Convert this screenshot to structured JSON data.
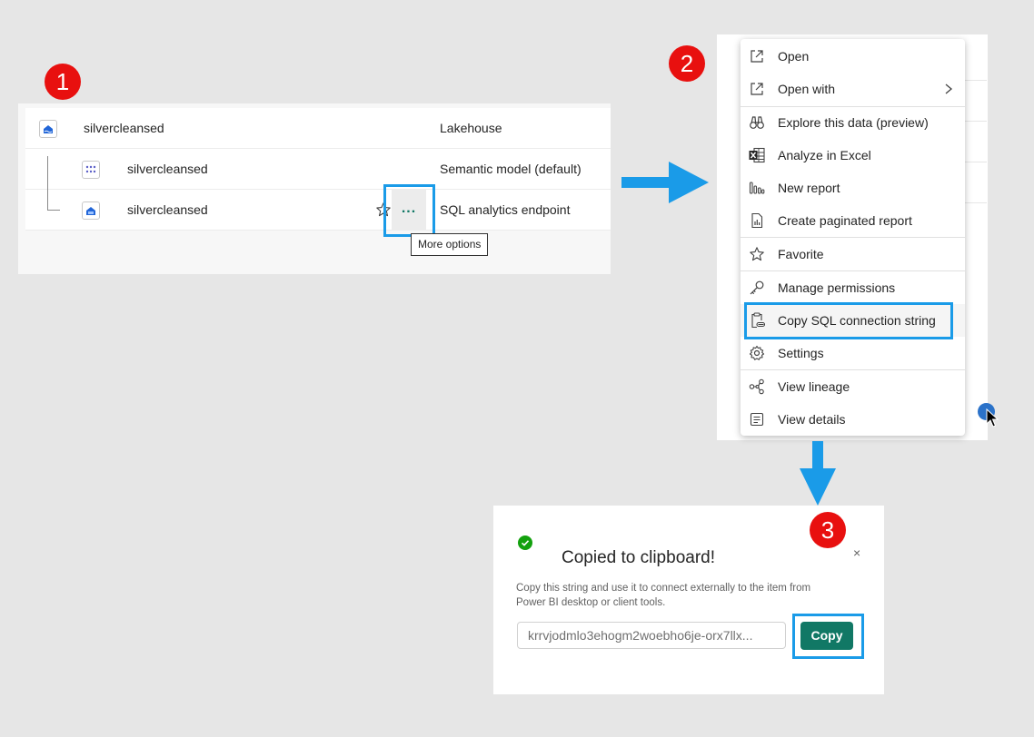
{
  "steps": [
    "1",
    "2",
    "3"
  ],
  "panel1": {
    "rows": [
      {
        "name": "silvercleansed",
        "type": "Lakehouse",
        "icon": "lakehouse-icon"
      },
      {
        "name": "silvercleansed",
        "type": "Semantic model (default)",
        "icon": "semantic-model-icon"
      },
      {
        "name": "silvercleansed",
        "type": "SQL analytics endpoint",
        "icon": "sql-endpoint-icon"
      }
    ],
    "more_button_label": "...",
    "tooltip": "More options"
  },
  "menu": {
    "items": [
      {
        "label": "Open",
        "icon": "open-external-icon"
      },
      {
        "label": "Open with",
        "icon": "open-external-icon",
        "has_submenu": true
      },
      {
        "label": "Explore this data (preview)",
        "icon": "binoculars-icon"
      },
      {
        "label": "Analyze in Excel",
        "icon": "excel-icon"
      },
      {
        "label": "New report",
        "icon": "report-bars-icon"
      },
      {
        "label": "Create paginated report",
        "icon": "paginated-report-icon"
      },
      {
        "label": "Favorite",
        "icon": "star-icon"
      },
      {
        "label": "Manage permissions",
        "icon": "key-icon"
      },
      {
        "label": "Copy SQL connection string",
        "icon": "clipboard-link-icon",
        "highlighted": true
      },
      {
        "label": "Settings",
        "icon": "gear-icon"
      },
      {
        "label": "View lineage",
        "icon": "lineage-icon"
      },
      {
        "label": "View details",
        "icon": "details-icon"
      }
    ]
  },
  "dialog": {
    "title": "Copied to clipboard!",
    "description": "Copy this string and use it to connect externally to the item from Power BI desktop or client tools.",
    "connection_string": "krrvjodmlo3ehogm2woebho6je-orx7llx...",
    "copy_label": "Copy",
    "close_label": "×",
    "success_icon": "check-circle-icon"
  },
  "colors": {
    "accent_blue": "#1a9be8",
    "badge_red": "#e8100f",
    "fabric_green": "#117865"
  }
}
